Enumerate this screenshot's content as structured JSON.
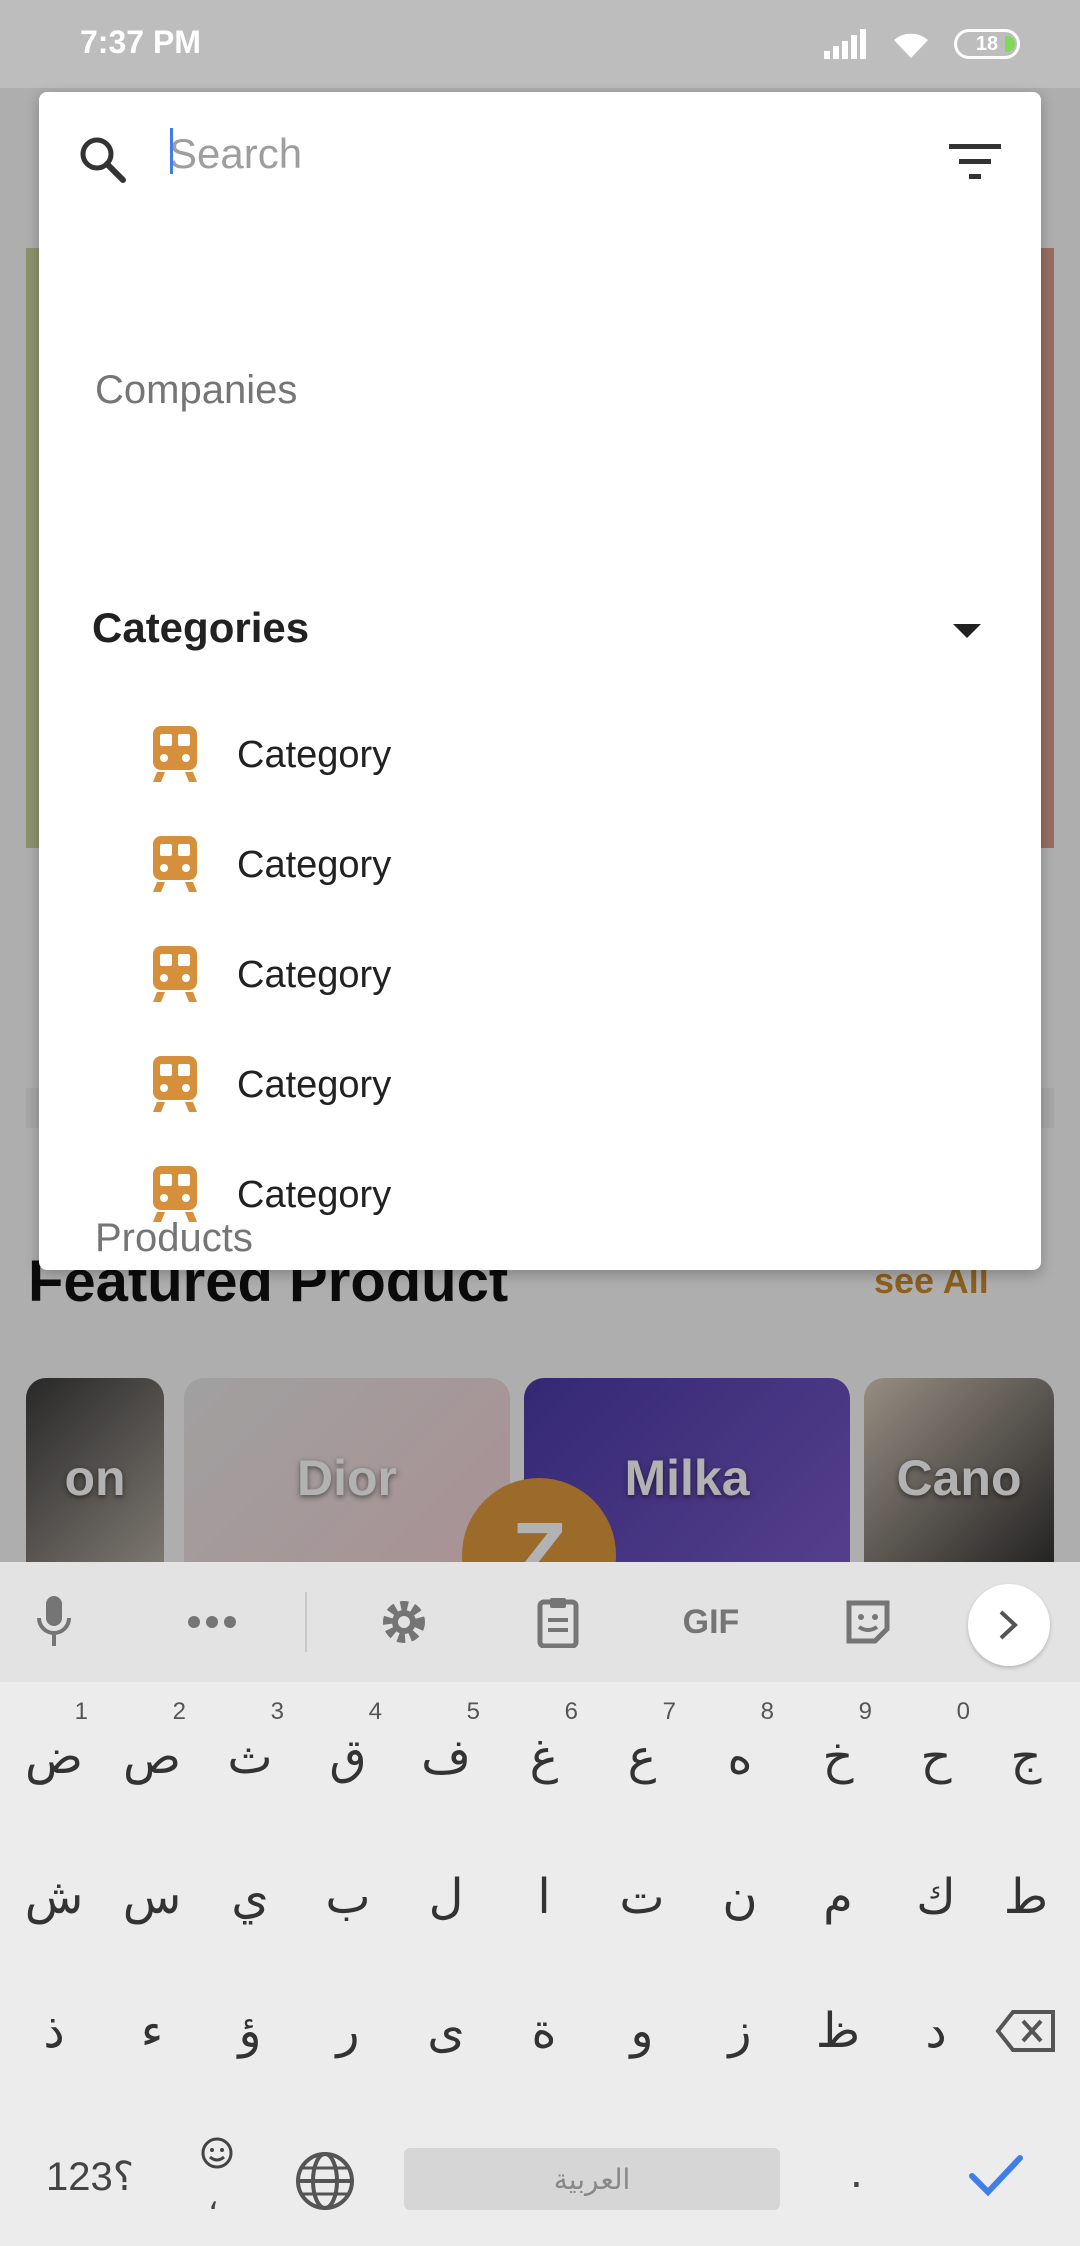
{
  "status_bar": {
    "time": "7:37 PM",
    "battery": "18"
  },
  "background": {
    "featured_title": "Featured Product",
    "see_all": "see All",
    "products": [
      "on",
      "Dior",
      "Milka",
      "Cano"
    ],
    "fab_letter": "Z"
  },
  "search": {
    "placeholder": "Search",
    "sections": {
      "companies": "Companies",
      "categories": "Categories",
      "products": "Products"
    },
    "categories": [
      {
        "label": "Category",
        "icon": "train-icon"
      },
      {
        "label": "Category",
        "icon": "train-icon"
      },
      {
        "label": "Category",
        "icon": "train-icon"
      },
      {
        "label": "Category",
        "icon": "train-icon"
      },
      {
        "label": "Category",
        "icon": "train-icon"
      }
    ],
    "accent_color": "#d68f3a"
  },
  "keyboard": {
    "toolbar": {
      "gif": "GIF"
    },
    "row1": [
      {
        "char": "ض",
        "hint": "1"
      },
      {
        "char": "ص",
        "hint": "2"
      },
      {
        "char": "ث",
        "hint": "3"
      },
      {
        "char": "ق",
        "hint": "4"
      },
      {
        "char": "ف",
        "hint": "5"
      },
      {
        "char": "غ",
        "hint": "6"
      },
      {
        "char": "ع",
        "hint": "7"
      },
      {
        "char": "ه",
        "hint": "8"
      },
      {
        "char": "خ",
        "hint": "9"
      },
      {
        "char": "ح",
        "hint": "0"
      },
      {
        "char": "ج",
        "hint": ""
      }
    ],
    "row2": [
      "ش",
      "س",
      "ي",
      "ب",
      "ل",
      "ا",
      "ت",
      "ن",
      "م",
      "ك",
      "ط"
    ],
    "row3": [
      "ذ",
      "ء",
      "ؤ",
      "ر",
      "ى",
      "ة",
      "و",
      "ز",
      "ظ",
      "د"
    ],
    "symbols": "؟123",
    "emoji_comma": "،",
    "space_label": "العربية",
    "dot": "."
  }
}
